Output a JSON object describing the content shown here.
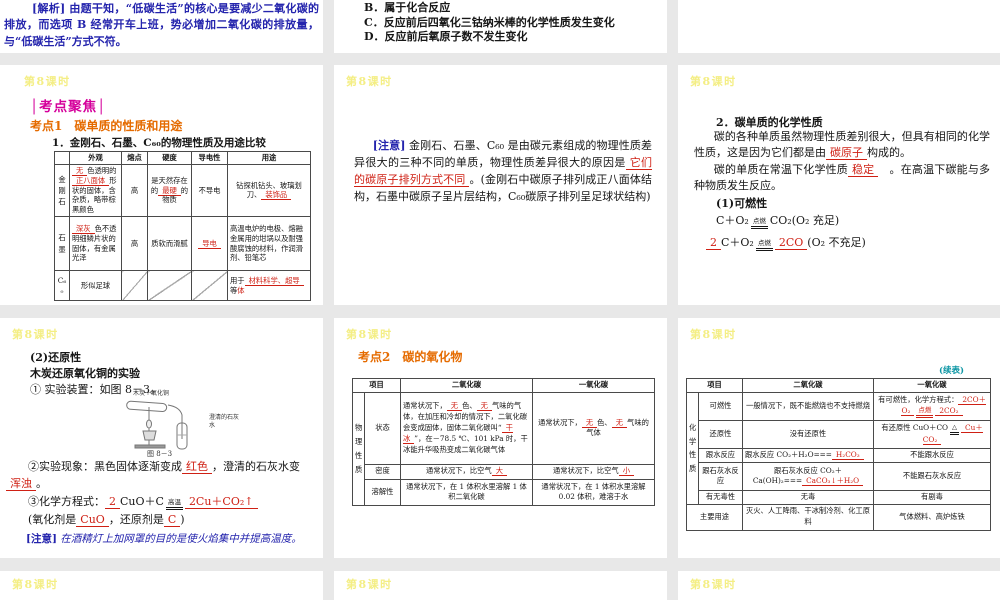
{
  "header_label": "第8课时",
  "row1": {
    "left_para": [
      {
        "t": "[解析]",
        "s": "bb"
      },
      {
        "t": " 由题干知，“低碳生活”的核心是要减少二氧化碳的排放，而选项 B 经常开车上班，势必增加二氧化碳的排放量，与“低碳生活”方式不符。",
        "s": "b"
      }
    ],
    "middle_options": [
      "B．属于化合反应",
      "C．反应前后四氧化三钴纳米棒的化学性质发生变化",
      "D．反应前后氧原子数不发生变化"
    ]
  },
  "focus": {
    "section_title": "│考点聚焦│",
    "topic1": "考点1　碳单质的性质和用途",
    "compare_title": "1．金刚石、石墨、C₆₀的物理性质及用途比较"
  },
  "allotrope_table": {
    "headers": [
      "",
      "外观",
      "熔点",
      "硬度",
      "导电性",
      "用途"
    ],
    "rows": [
      {
        "label": "金刚石",
        "appearance": [
          {
            "t": "无",
            "s": "ru"
          },
          {
            "t": "色透明的",
            "s": "n"
          },
          {
            "t": "正八面体",
            "s": "ru"
          },
          {
            "t": "形状的固体，含杂质，略带棕黑颜色",
            "s": "n"
          }
        ],
        "melting": "高",
        "hardness": [
          {
            "t": "是天然存在的",
            "s": "n"
          },
          {
            "t": "最硬",
            "s": "ru"
          },
          {
            "t": "的物质",
            "s": "n"
          }
        ],
        "conductivity": [
          {
            "t": "不导电",
            "s": "n"
          }
        ],
        "uses": [
          {
            "t": "钻探机钻头、玻璃划刀、",
            "s": "n"
          },
          {
            "t": "装饰品",
            "s": "ru"
          }
        ]
      },
      {
        "label": "石墨",
        "appearance": [
          {
            "t": "深灰",
            "s": "ru"
          },
          {
            "t": "色不透明细鳞片状的固体，有金属光泽",
            "s": "n"
          }
        ],
        "melting": "高",
        "hardness": [
          {
            "t": "质软而滑腻",
            "s": "n"
          }
        ],
        "conductivity": [
          {
            "t": "导电",
            "s": "ru"
          }
        ],
        "uses": [
          {
            "t": "高温电炉的电极、熔融金属用的坩埚以及耐强酸腐蚀的材料，作润滑剂、铅笔芯",
            "s": "n"
          }
        ]
      },
      {
        "label": "C₆₀",
        "appearance": [
          {
            "t": "形似足球",
            "s": "n"
          }
        ],
        "uses": [
          {
            "t": "用于",
            "s": "n"
          },
          {
            "t": "材料科学、超导",
            "s": "ru"
          },
          {
            "t": "等",
            "s": "n"
          },
          {
            "t": "体",
            "s": "r"
          }
        ]
      }
    ]
  },
  "note_allotropes": [
    {
      "t": "[注意]",
      "s": "bb"
    },
    {
      "t": " 金刚石、石墨、C₆₀ 是由碳元素组成的物理性质差异很大的三种不同的单质，物理性质差异很大的原因是",
      "s": "n"
    },
    {
      "t": "它们的碳原子排列方式不同",
      "s": "ru"
    },
    {
      "t": "。(金刚石中碳原子排列成正八面体结构，石墨中碳原子呈片层结构，C₆₀碳原子排列呈足球状结构)",
      "s": "n"
    }
  ],
  "chem_props": {
    "title": "2．碳单质的化学性质",
    "p1": [
      {
        "t": "碳的各种单质虽然物理性质差别很大，但具有相同的化学性质，这是因为它们都是由",
        "s": "n"
      },
      {
        "t": "碳原子",
        "s": "ru"
      },
      {
        "t": "构成的。",
        "s": "n"
      }
    ],
    "p2": [
      {
        "t": "碳的单质在常温下化学性质",
        "s": "n"
      },
      {
        "t": "稳定",
        "s": "ru"
      },
      {
        "t": "　。在高温下碳能与多种物质发生反应。",
        "s": "n"
      }
    ],
    "flammability": "(1)可燃性",
    "eq1": [
      {
        "t": "C＋O₂",
        "s": "n"
      },
      {
        "t": "点燃",
        "s": "eq"
      },
      {
        "t": "CO₂(O₂ 充足)",
        "s": "n"
      }
    ],
    "eq2": [
      {
        "t": "2",
        "s": "ru"
      },
      {
        "t": "C＋O₂",
        "s": "n"
      },
      {
        "t": "点燃",
        "s": "eq"
      },
      {
        "t": "2CO",
        "s": "ru"
      },
      {
        "t": "(O₂ 不充足)",
        "s": "n"
      }
    ]
  },
  "reduction": {
    "title": "(2)还原性",
    "subtitle": "木炭还原氧化铜的实验",
    "step1": "① 实验装置：如图 8－3。",
    "diagram": {
      "label_top": "木炭＋氧化铜",
      "label_right": "澄清的石灰水",
      "caption": "图 8－3"
    },
    "step2": [
      {
        "t": "②实验现象：黑色固体逐渐变成",
        "s": "n"
      },
      {
        "t": "红色",
        "s": "ru"
      },
      {
        "t": "，澄清的石灰水变",
        "s": "n"
      }
    ],
    "step2b": [
      {
        "t": "浑浊",
        "s": "ru"
      },
      {
        "t": "。",
        "s": "n"
      }
    ],
    "step3": [
      {
        "t": "③化学方程式：",
        "s": "n"
      },
      {
        "t": "2",
        "s": "ru"
      },
      {
        "t": "CuO＋C",
        "s": "n"
      },
      {
        "t": "高温",
        "s": "eq"
      },
      {
        "t": "2Cu＋CO₂↑",
        "s": "ru"
      }
    ],
    "step3b": [
      {
        "t": "(氧化剂是",
        "s": "n"
      },
      {
        "t": "CuO",
        "s": "ru"
      },
      {
        "t": "，还原剂是",
        "s": "n"
      },
      {
        "t": "C",
        "s": "ru"
      },
      {
        "t": ")",
        "s": "n"
      }
    ],
    "note": [
      {
        "t": "[注意]",
        "s": "bb"
      },
      {
        "t": " 在酒精灯上加网罩的目的是使火焰集中并提高温度。",
        "s": "bi"
      }
    ]
  },
  "oxides": {
    "topic2": "考点2　碳的氧化物",
    "cont_label": "(续表)",
    "phys_table": {
      "headers": [
        "项目",
        "二氧化碳",
        "一氧化碳"
      ],
      "group_label": "物理性质",
      "rows": [
        {
          "label": "状态",
          "co2": [
            {
              "t": "通常状况下，",
              "s": "n"
            },
            {
              "t": "无",
              "s": "ru"
            },
            {
              "t": "色、",
              "s": "n"
            },
            {
              "t": "无",
              "s": "ru"
            },
            {
              "t": "气味的气体，在加压和冷却的情况下，二氧化碳会变成固体，固体二氧化碳叫“",
              "s": "n"
            },
            {
              "t": "干冰",
              "s": "ru"
            },
            {
              "t": "”，在－78.5 ℃、101 kPa 时，干冰能升华吸热变成二氧化碳气体",
              "s": "n"
            }
          ],
          "co": [
            {
              "t": "通常状况下，",
              "s": "n"
            },
            {
              "t": "无",
              "s": "ru"
            },
            {
              "t": "色、",
              "s": "n"
            },
            {
              "t": "无",
              "s": "ru"
            },
            {
              "t": "气味的气体",
              "s": "n"
            }
          ]
        },
        {
          "label": "密度",
          "co2": [
            {
              "t": "通常状况下，比空气",
              "s": "n"
            },
            {
              "t": "大",
              "s": "ru"
            }
          ],
          "co": [
            {
              "t": "通常状况下，比空气",
              "s": "n"
            },
            {
              "t": "小",
              "s": "ru"
            }
          ]
        },
        {
          "label": "溶解性",
          "co2": [
            {
              "t": "通常状况下，在 1 体积水里溶解 1 体积二氧化碳",
              "s": "n"
            }
          ],
          "co": [
            {
              "t": "通常状况下，在 1 体积水里溶解 0.02 体积，难溶于水",
              "s": "n"
            }
          ]
        }
      ]
    },
    "chem_table": {
      "headers": [
        "项目",
        "二氧化碳",
        "一氧化碳"
      ],
      "group_label": "化学性质",
      "rows": [
        {
          "label": "可燃性",
          "co2": [
            {
              "t": "一般情况下，既不能燃烧也不支持燃烧",
              "s": "n"
            }
          ],
          "co": [
            {
              "t": "有可燃性，化学方程式：",
              "s": "n"
            },
            {
              "t": "2CO＋O₂",
              "s": "ru"
            },
            {
              "t": "点燃",
              "s": "eqr"
            },
            {
              "t": "2CO₂",
              "s": "ru"
            }
          ]
        },
        {
          "label": "还原性",
          "co2": [
            {
              "t": "没有还原性",
              "s": "n"
            }
          ],
          "co": [
            {
              "t": "有还原性 ",
              "s": "n"
            },
            {
              "t": "CuO＋CO",
              "s": "n"
            },
            {
              "t": "△",
              "s": "eq"
            },
            {
              "t": "Cu＋CO₂",
              "s": "ru"
            }
          ]
        },
        {
          "label": "跟水反应",
          "co2": [
            {
              "t": "跟水反应 CO₂＋H₂O===",
              "s": "n"
            },
            {
              "t": "H₂CO₃",
              "s": "ru"
            }
          ],
          "co": [
            {
              "t": "不能跟水反应",
              "s": "n"
            }
          ]
        },
        {
          "label": "跟石灰水反应",
          "co2": [
            {
              "t": "跟石灰水反应 ",
              "s": "n"
            },
            {
              "t": "CO₂＋Ca(OH)₂===",
              "s": "n"
            },
            {
              "t": "CaCO₃↓＋H₂O",
              "s": "ru"
            }
          ],
          "co": [
            {
              "t": "不能跟石灰水反应",
              "s": "n"
            }
          ]
        },
        {
          "label": "有无毒性",
          "co2": [
            {
              "t": "无毒",
              "s": "n"
            }
          ],
          "co": [
            {
              "t": "有剧毒",
              "s": "n"
            }
          ]
        },
        {
          "label": "主要用途",
          "co2": [
            {
              "t": "灭火、人工降雨、干冰制冷剂、化工原料",
              "s": "n"
            }
          ],
          "co": [
            {
              "t": "气体燃料、高炉炼铁",
              "s": "n"
            }
          ]
        }
      ]
    }
  }
}
